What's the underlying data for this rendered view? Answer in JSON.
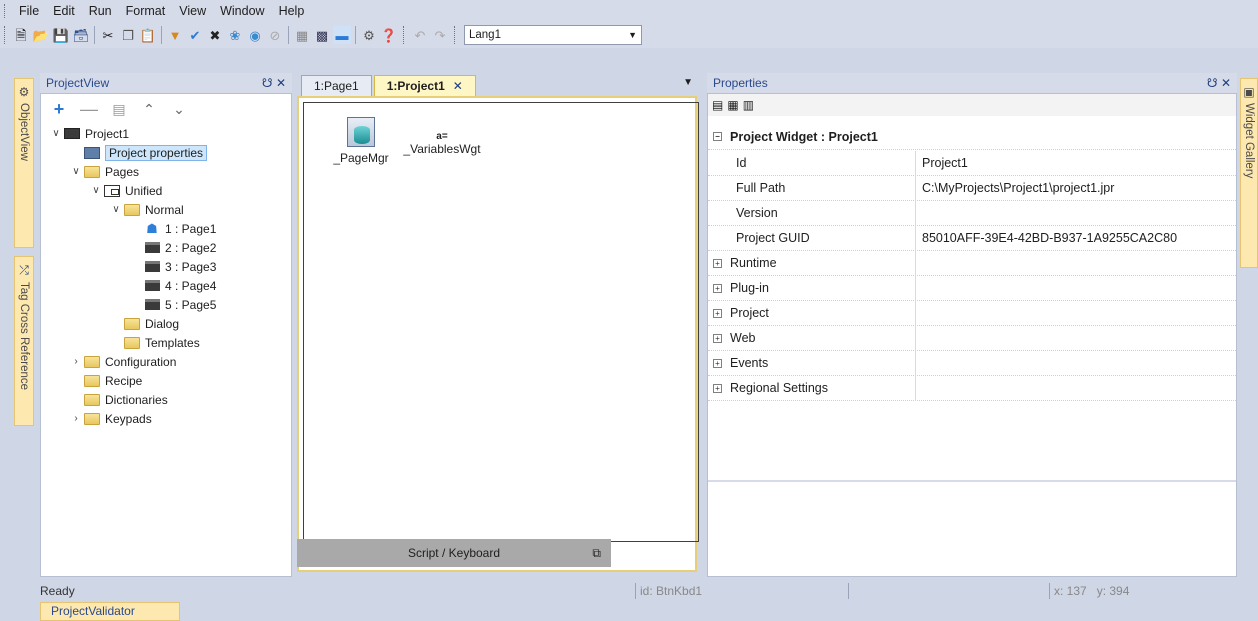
{
  "menu": [
    "File",
    "Edit",
    "Run",
    "Format",
    "View",
    "Window",
    "Help"
  ],
  "toolbar": {
    "icons": [
      "new-icon",
      "open-icon",
      "save-icon",
      "save-all-icon",
      "cut-icon",
      "copy-icon",
      "paste-icon",
      "download-icon",
      "check-icon",
      "build-icon",
      "debug-icon",
      "simulate-icon",
      "stop-icon",
      "grid-icon",
      "snap-icon",
      "align-icon",
      "settings-icon",
      "help-icon",
      "undo-icon",
      "redo-icon"
    ],
    "language": "Lang1"
  },
  "left_strip": {
    "object_view": "ObjectView",
    "tag_cross_reference": "Tag Cross Reference"
  },
  "right_strip": {
    "widget_gallery": "Widget Gallery"
  },
  "project_view": {
    "title": "ProjectView",
    "tree": [
      {
        "label": "Project1",
        "indent": 0,
        "chev": "v",
        "icon": "project"
      },
      {
        "label": "Project properties",
        "indent": 1,
        "chev": "",
        "icon": "props",
        "selected": true
      },
      {
        "label": "Pages",
        "indent": 1,
        "chev": "v",
        "icon": "folder"
      },
      {
        "label": "Unified",
        "indent": 2,
        "chev": "v",
        "icon": "unified"
      },
      {
        "label": "Normal",
        "indent": 3,
        "chev": "v",
        "icon": "folder"
      },
      {
        "label": "1 : Page1",
        "indent": 4,
        "chev": "",
        "icon": "home"
      },
      {
        "label": "2 : Page2",
        "indent": 4,
        "chev": "",
        "icon": "page"
      },
      {
        "label": "3 : Page3",
        "indent": 4,
        "chev": "",
        "icon": "page"
      },
      {
        "label": "4 : Page4",
        "indent": 4,
        "chev": "",
        "icon": "page"
      },
      {
        "label": "5 : Page5",
        "indent": 4,
        "chev": "",
        "icon": "page"
      },
      {
        "label": "Dialog",
        "indent": 3,
        "chev": "",
        "icon": "folder"
      },
      {
        "label": "Templates",
        "indent": 3,
        "chev": "",
        "icon": "folder"
      },
      {
        "label": "Configuration",
        "indent": 1,
        "chev": ">",
        "icon": "folder"
      },
      {
        "label": "Recipe",
        "indent": 1,
        "chev": "",
        "icon": "folder"
      },
      {
        "label": "Dictionaries",
        "indent": 1,
        "chev": "",
        "icon": "folder"
      },
      {
        "label": "Keypads",
        "indent": 1,
        "chev": ">",
        "icon": "folder"
      }
    ]
  },
  "editor": {
    "tabs": [
      {
        "label": "1:Page1",
        "active": false
      },
      {
        "label": "1:Project1",
        "active": true
      }
    ],
    "widgets": [
      {
        "label": "_PageMgr"
      },
      {
        "label": "_VariablesWgt",
        "glyph": "a="
      }
    ],
    "script_bar": "Script / Keyboard"
  },
  "properties": {
    "title": "Properties",
    "section": "Project Widget : Project1",
    "rows": [
      {
        "key": "Id",
        "value": "Project1",
        "expandable": false
      },
      {
        "key": "Full Path",
        "value": "C:\\MyProjects\\Project1\\project1.jpr",
        "expandable": false
      },
      {
        "key": "Version",
        "value": "",
        "expandable": false
      },
      {
        "key": "Project GUID",
        "value": "85010AFF-39E4-42BD-B937-1A9255CA2C80",
        "expandable": false
      },
      {
        "key": "Runtime",
        "value": "",
        "expandable": true
      },
      {
        "key": "Plug-in",
        "value": "",
        "expandable": true
      },
      {
        "key": "Project",
        "value": "",
        "expandable": true
      },
      {
        "key": "Web",
        "value": "",
        "expandable": true
      },
      {
        "key": "Events",
        "value": "",
        "expandable": true
      },
      {
        "key": "Regional Settings",
        "value": "",
        "expandable": true
      }
    ]
  },
  "status": {
    "ready": "Ready",
    "id": "id: BtnKbd1",
    "x": "x: 137",
    "y": "y: 394"
  },
  "bottom_tab": "ProjectValidator"
}
